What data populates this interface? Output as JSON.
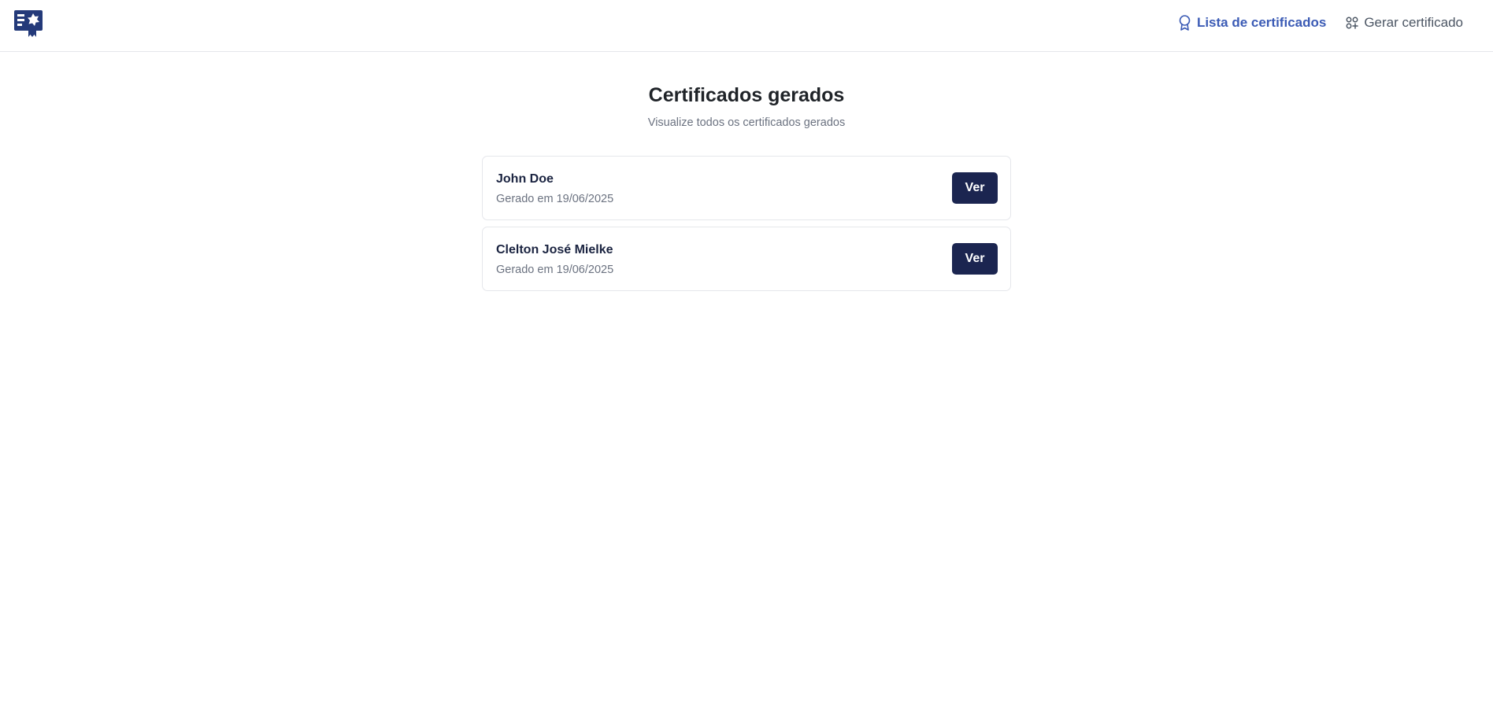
{
  "nav": {
    "logo_icon": "certificate-badge-icon",
    "links": [
      {
        "label": "Lista de certificados",
        "icon": "award-ribbon-icon",
        "active": true
      },
      {
        "label": "Gerar certificado",
        "icon": "grid-plus-icon",
        "active": false
      }
    ]
  },
  "page": {
    "title": "Certificados gerados",
    "subtitle": "Visualize todos os certificados gerados"
  },
  "certificates": [
    {
      "name": "John Doe",
      "date": "Gerado em 19/06/2025",
      "action_label": "Ver"
    },
    {
      "name": "Clelton José Mielke",
      "date": "Gerado em 19/06/2025",
      "action_label": "Ver"
    }
  ],
  "colors": {
    "accent": "#3b5bb5",
    "button_bg": "#1b2550",
    "muted_text": "#6b7280",
    "border": "#e5e7eb"
  }
}
